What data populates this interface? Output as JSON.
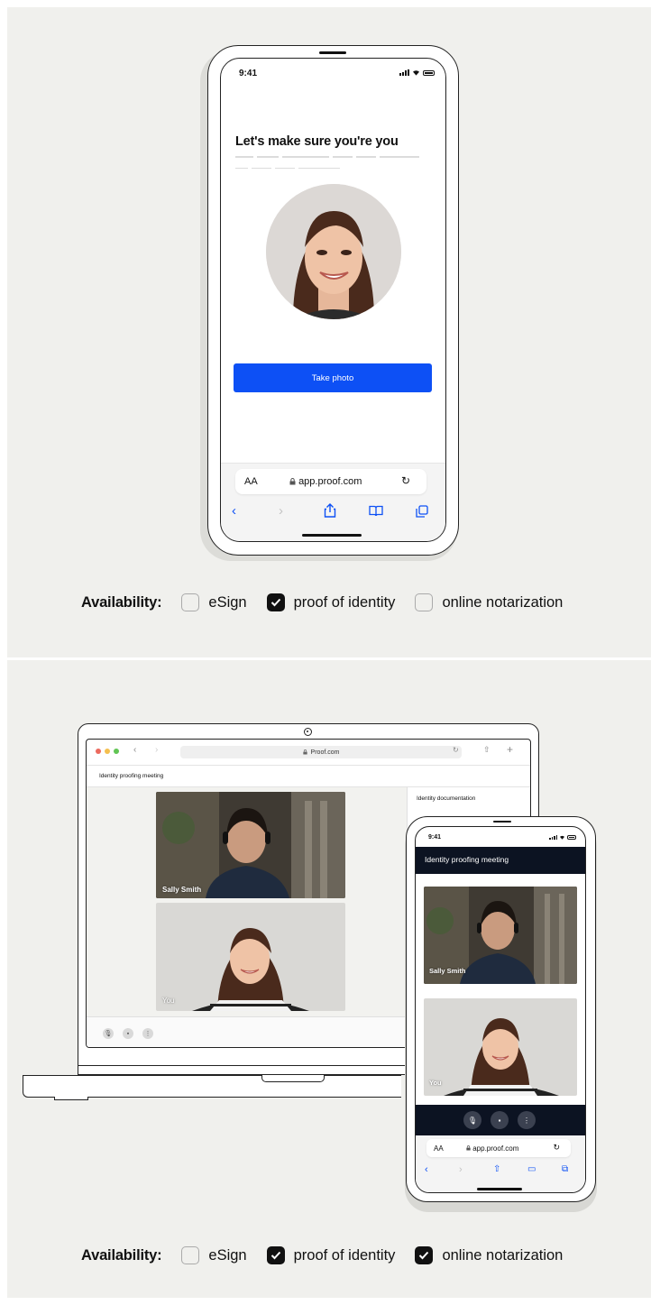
{
  "top_panel": {
    "phone": {
      "status_time": "9:41",
      "headline": "Let's make sure you're you",
      "primary_button_label": "Take photo",
      "browser": {
        "text_size_label": "AA",
        "url": "app.proof.com",
        "icons": [
          "lock-icon",
          "reload-icon",
          "back-icon",
          "forward-icon",
          "share-icon",
          "bookmarks-icon",
          "tabs-icon"
        ]
      }
    },
    "availability": {
      "title": "Availability:",
      "options": [
        {
          "label": "eSign",
          "checked": false
        },
        {
          "label": "proof of identity",
          "checked": true
        },
        {
          "label": "online notarization",
          "checked": false
        }
      ]
    }
  },
  "bottom_panel": {
    "laptop": {
      "browser_url": "Proof.com",
      "page_title": "Identity proofing meeting",
      "sidebar_title": "Identity documentation",
      "participants": [
        {
          "label": "Sally Smith"
        },
        {
          "label": "You"
        }
      ],
      "controls": [
        "mic-icon",
        "chat-icon",
        "more-icon"
      ]
    },
    "phone": {
      "status_time": "9:41",
      "header_title": "Identity proofing meeting",
      "participants": [
        {
          "label": "Sally Smith"
        },
        {
          "label": "You"
        }
      ],
      "controls": [
        "mic-icon",
        "chat-icon",
        "more-icon"
      ],
      "browser": {
        "text_size_label": "AA",
        "url": "app.proof.com"
      }
    },
    "availability": {
      "title": "Availability:",
      "options": [
        {
          "label": "eSign",
          "checked": false
        },
        {
          "label": "proof of identity",
          "checked": true
        },
        {
          "label": "online notarization",
          "checked": true
        }
      ]
    }
  },
  "colors": {
    "panel_background": "#f0f0ed",
    "primary_button": "#0d50f5",
    "meeting_header": "#0c1322",
    "checkbox_checked": "#111111"
  }
}
